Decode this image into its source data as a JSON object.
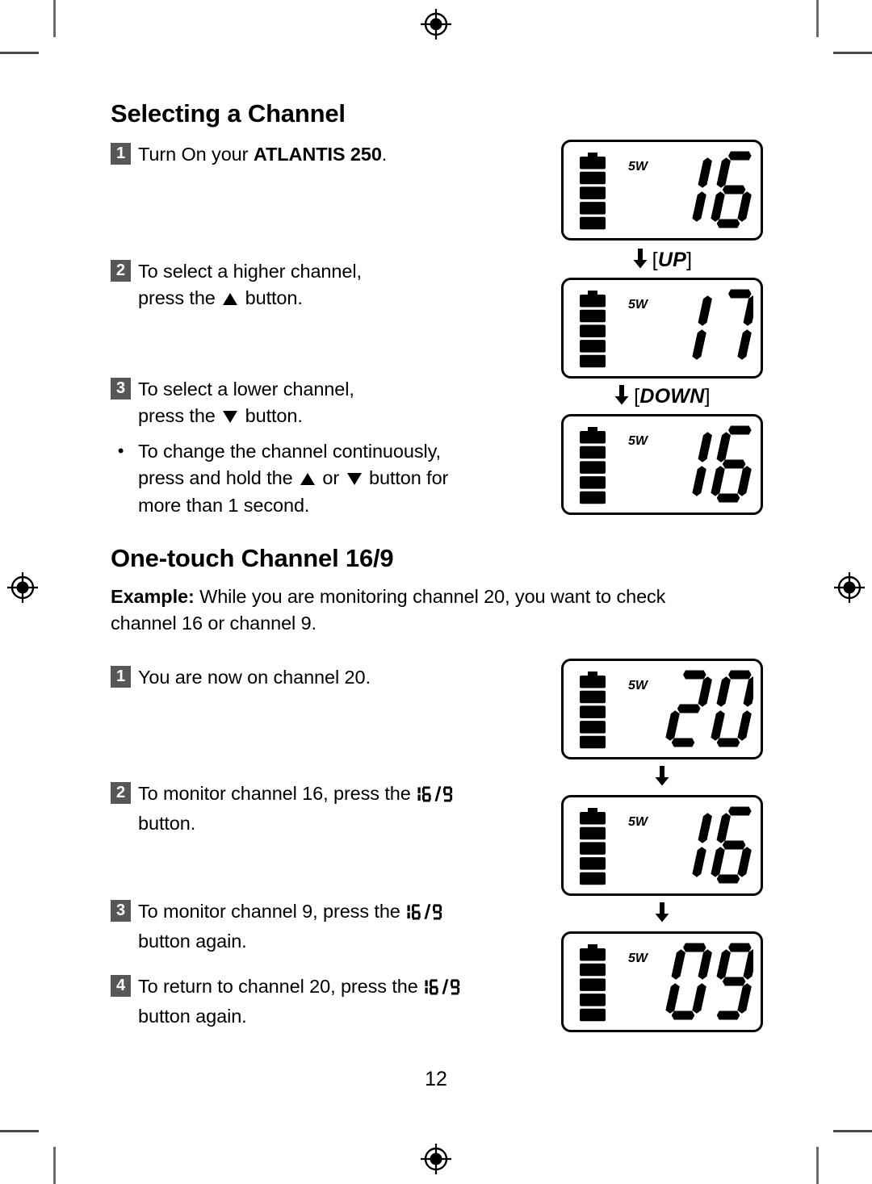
{
  "page": {
    "number": "12"
  },
  "sections": [
    {
      "title": "Selecting a Channel",
      "steps": [
        {
          "num": "1",
          "text_before": "Turn On your ",
          "text_bold": "ATLANTIS 250",
          "text_after": "."
        },
        {
          "num": "2",
          "line1": "To select a higher channel,",
          "line2_before": "press the ",
          "line2_icon": "triangle-up",
          "line2_after": " button."
        },
        {
          "num": "3",
          "line1": "To select a lower channel,",
          "line2_before": "press the ",
          "line2_icon": "triangle-down",
          "line2_after": " button."
        }
      ],
      "bullet": {
        "marker": "•",
        "line1": "To change the channel continuously,",
        "line2_before": "press and hold the ",
        "line2_mid": " or ",
        "line2_after": " button for",
        "line3": "more than 1 second."
      }
    },
    {
      "title": "One-touch Channel 16/9",
      "example_label": "Example:",
      "example_text": " While you are monitoring channel 20, you want to check",
      "example_line2": "channel 16 or channel 9.",
      "steps": [
        {
          "num": "1",
          "line1": "You are now on channel 20."
        },
        {
          "num": "2",
          "line1_before": "To monitor channel 16, press the ",
          "line1_icon": "seg-16-9-button",
          "line2": "button."
        },
        {
          "num": "3",
          "line1_before": "To monitor channel 9, press the ",
          "line1_icon": "seg-16-9-button",
          "line2": "button again."
        },
        {
          "num": "4",
          "line1_before": "To return to channel 20, press the ",
          "line1_icon": "seg-16-9-button",
          "line2": "button again."
        }
      ]
    }
  ],
  "displays": [
    {
      "id": "lcd-16-initial",
      "power": "5W",
      "channel": "16",
      "battery_bars": 5
    },
    {
      "id": "lcd-17-up",
      "power": "5W",
      "channel": "17",
      "battery_bars": 5
    },
    {
      "id": "lcd-16-down",
      "power": "5W",
      "channel": "16",
      "battery_bars": 5
    },
    {
      "id": "lcd-20",
      "power": "5W",
      "channel": "20",
      "battery_bars": 5
    },
    {
      "id": "lcd-16-onetouch",
      "power": "5W",
      "channel": "16",
      "battery_bars": 5
    },
    {
      "id": "lcd-09",
      "power": "5W",
      "channel": "09",
      "battery_bars": 5
    }
  ],
  "transitions": [
    {
      "id": "t-up",
      "arrow": "arrow-down-icon",
      "open": "[",
      "label": "UP",
      "close": "]"
    },
    {
      "id": "t-down",
      "arrow": "arrow-down-icon",
      "open": "[",
      "label": "DOWN",
      "close": "]"
    },
    {
      "id": "t-1",
      "arrow": "arrow-down-icon",
      "open": "",
      "label": "",
      "close": ""
    },
    {
      "id": "t-2",
      "arrow": "arrow-down-icon",
      "open": "",
      "label": "",
      "close": ""
    }
  ],
  "colors": {
    "step_badge_bg": "#575757",
    "step_badge_fg": "#ffffff",
    "ink": "#000000",
    "crop_mark": "#5a5a5a"
  }
}
